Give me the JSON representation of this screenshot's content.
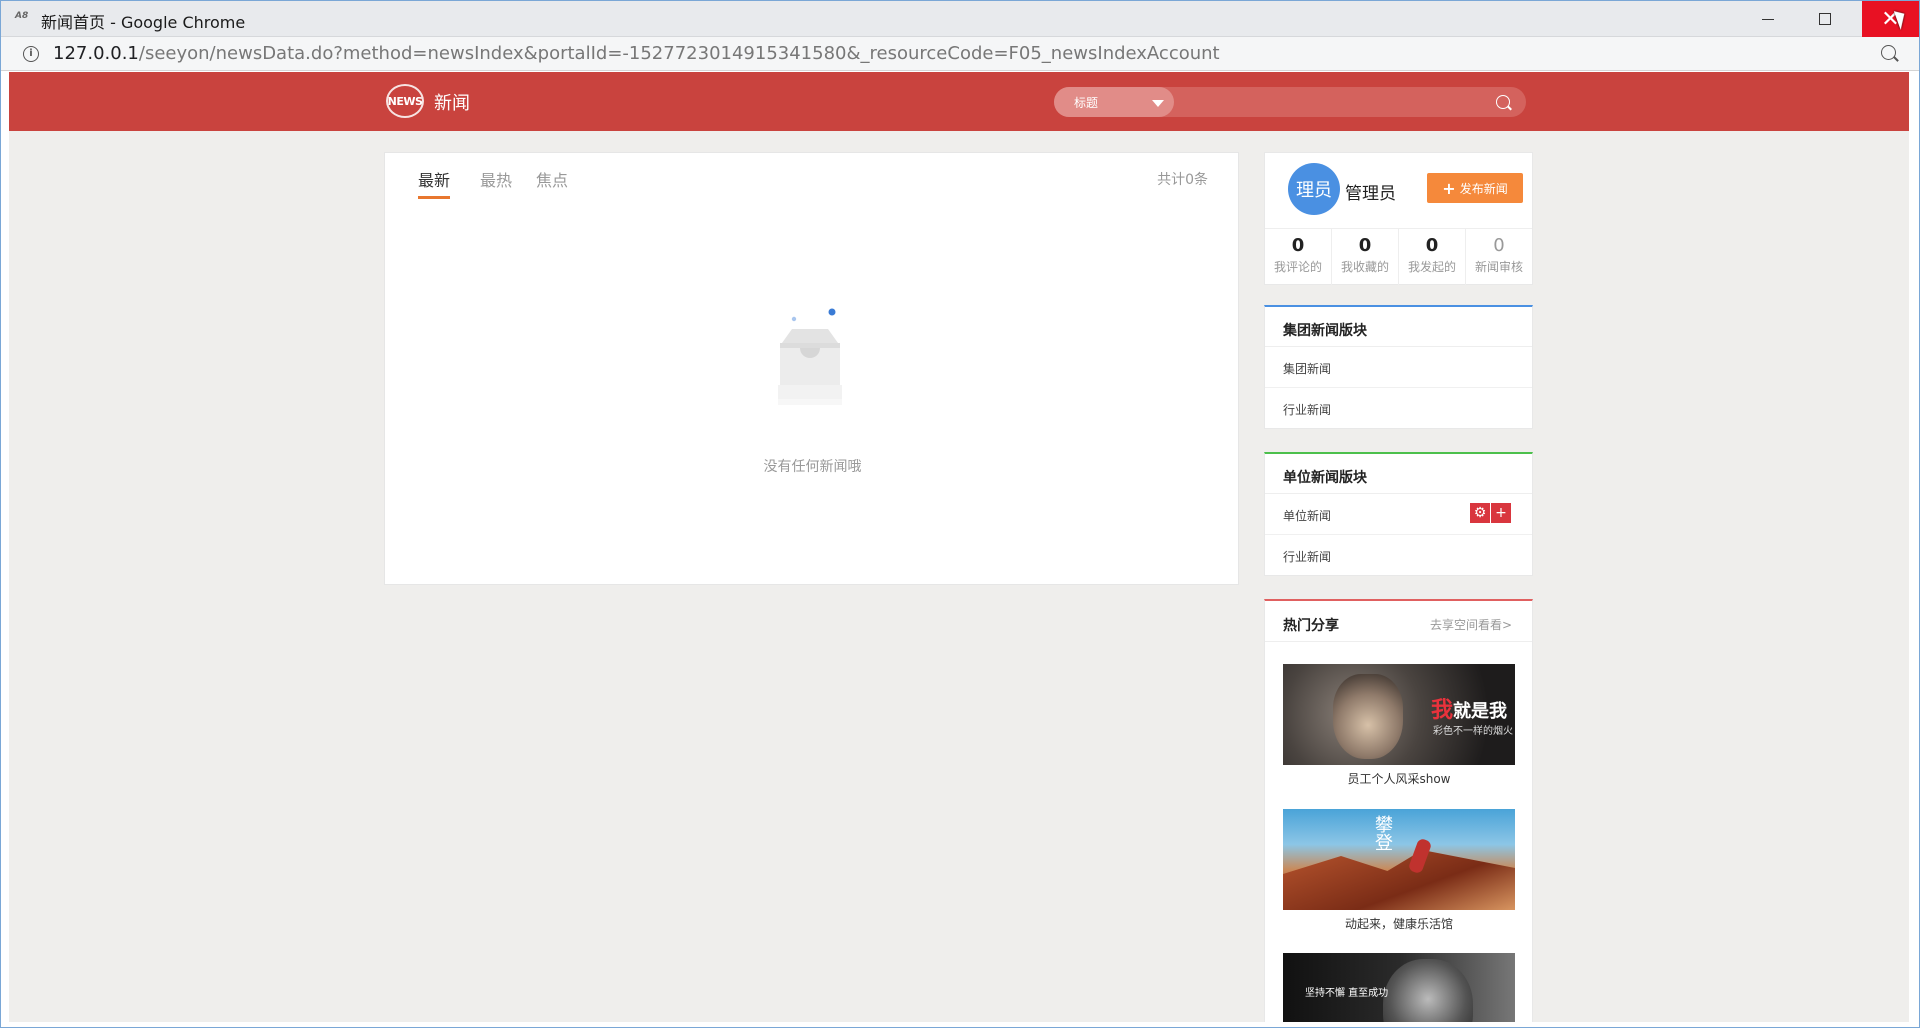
{
  "window": {
    "title": "新闻首页 - Google Chrome",
    "url_host": "127.0.0.1",
    "url_path": "/seeyon/newsData.do?method=newsIndex&portalId=-1527723014915341580&_resourceCode=F05_newsIndexAccount"
  },
  "header": {
    "logo_text": "NEWS",
    "title": "新闻",
    "search": {
      "category": "标题",
      "placeholder": ""
    }
  },
  "main": {
    "tabs": [
      {
        "label": "最新",
        "active": true
      },
      {
        "label": "最热",
        "active": false
      },
      {
        "label": "焦点",
        "active": false
      }
    ],
    "total": "共计0条",
    "empty_text": "没有任何新闻哦"
  },
  "user": {
    "avatar_text": "理员",
    "name": "管理员",
    "publish_label": "发布新闻",
    "stats": [
      {
        "value": "0",
        "label": "我评论的"
      },
      {
        "value": "0",
        "label": "我收藏的"
      },
      {
        "value": "0",
        "label": "我发起的"
      },
      {
        "value": "0",
        "label": "新闻审核"
      }
    ]
  },
  "group_section": {
    "title": "集团新闻版块",
    "items": [
      "集团新闻",
      "行业新闻"
    ]
  },
  "unit_section": {
    "title": "单位新闻版块",
    "items": [
      "单位新闻",
      "行业新闻"
    ]
  },
  "hot_share": {
    "title": "热门分享",
    "more": "去享空间看看>",
    "items": [
      {
        "caption": "员工个人风采show",
        "img_main": "我",
        "img_rest": "就是我",
        "img_sub": "彩色不一样的烟火"
      },
      {
        "caption": "动起来，健康乐活馆",
        "img_text": "攀登"
      },
      {
        "caption": "",
        "img_text": "坚持不懈 直至成功"
      }
    ]
  },
  "colors": {
    "header": "#c9433e",
    "accent_orange": "#f5893b",
    "avatar_blue": "#4a90e2",
    "group_border": "#4a90e2",
    "unit_border": "#4cc04c",
    "hot_border": "#e06060"
  }
}
